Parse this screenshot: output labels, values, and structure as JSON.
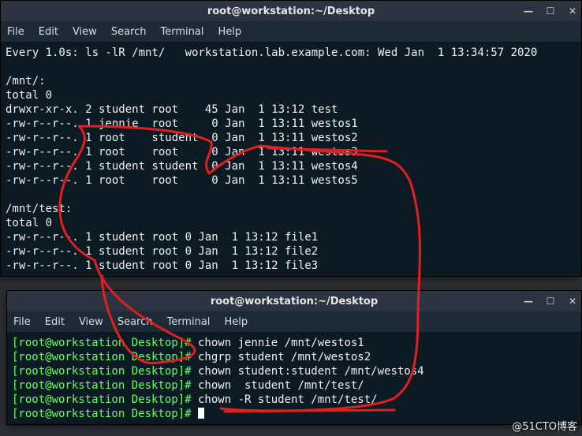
{
  "window1": {
    "title": "root@workstation:~/Desktop",
    "menu": [
      "File",
      "Edit",
      "View",
      "Search",
      "Terminal",
      "Help"
    ],
    "header": "Every 1.0s: ls -lR /mnt/   workstation.lab.example.com: Wed Jan  1 13:34:57 2020",
    "body_lines": [
      "",
      "/mnt/:",
      "total 0",
      "drwxr-xr-x. 2 student root    45 Jan  1 13:12 test",
      "-rw-r--r--. 1 jennie  root     0 Jan  1 13:11 westos1",
      "-rw-r--r--. 1 root    student  0 Jan  1 13:11 westos2",
      "-rw-r--r--. 1 root    root     0 Jan  1 13:11 westos3",
      "-rw-r--r--. 1 student student  0 Jan  1 13:11 westos4",
      "-rw-r--r--. 1 root    root     0 Jan  1 13:11 westos5",
      "",
      "/mnt/test:",
      "total 0",
      "-rw-r--r--. 1 student root 0 Jan  1 13:12 file1",
      "-rw-r--r--. 1 student root 0 Jan  1 13:12 file2",
      "-rw-r--r--. 1 student root 0 Jan  1 13:12 file3"
    ]
  },
  "window2": {
    "title": "root@workstation:~/Desktop",
    "menu": [
      "File",
      "Edit",
      "View",
      "Search",
      "Terminal",
      "Help"
    ],
    "prompt": "[root@workstation Desktop]#",
    "commands": [
      "chown jennie /mnt/westos1",
      "chgrp student /mnt/westos2",
      "chown student:student /mnt/westos4",
      "chown  student /mnt/test/",
      "chown -R student /mnt/test/",
      ""
    ]
  },
  "win_icons": {
    "min": "—",
    "max": "☐",
    "close": "✕"
  },
  "watermark": "@51CTO博客"
}
